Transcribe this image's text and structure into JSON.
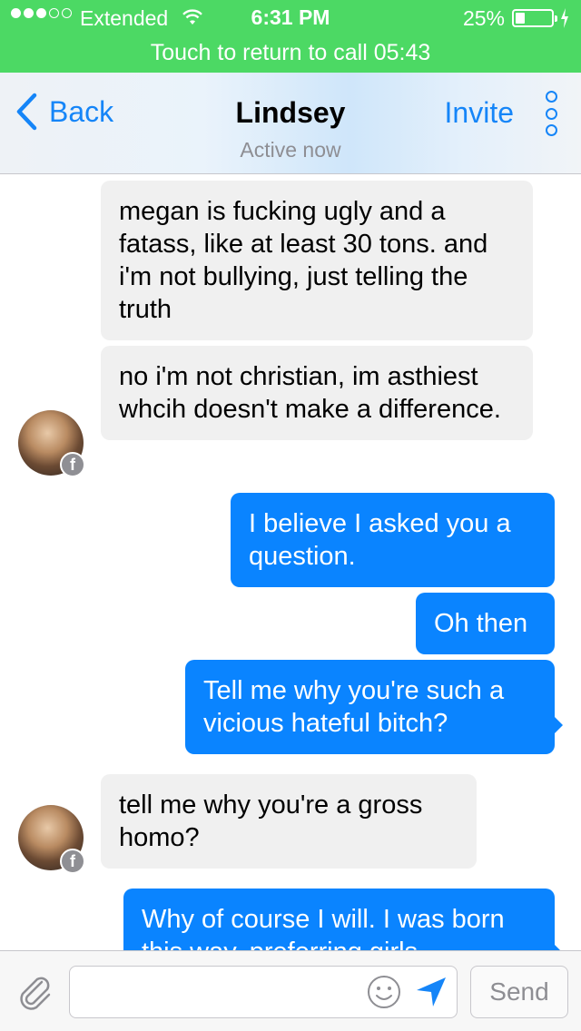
{
  "status_bar": {
    "carrier": "Extended",
    "time": "6:31 PM",
    "battery": "25%",
    "signal_bars_filled": 3,
    "signal_bars_total": 5,
    "battery_level": 0.25
  },
  "call_bar": {
    "text": "Touch to return to call  05:43"
  },
  "header": {
    "back_label": "Back",
    "title": "Lindsey",
    "subtitle": "Active now",
    "invite_label": "Invite"
  },
  "messages": [
    {
      "sender": "other",
      "text": "megan is fucking ugly and a fatass, like at least 30 tons. and i'm not bullying, just telling the truth"
    },
    {
      "sender": "other",
      "text": "no i'm not christian, im asthiest whcih doesn't make a difference."
    },
    {
      "sender": "me",
      "text": "I believe I asked you a question."
    },
    {
      "sender": "me",
      "text": "Oh then"
    },
    {
      "sender": "me",
      "text": "Tell me why you're such a vicious hateful bitch?"
    },
    {
      "sender": "other",
      "text": "tell me why you're a gross homo?"
    },
    {
      "sender": "me",
      "text": "Why of course I will. I was born this way, preferring girls"
    }
  ],
  "composer": {
    "input_value": "",
    "send_label": "Send",
    "badge_letter": "f"
  },
  "icons": {
    "wifi": "wifi-icon",
    "battery": "battery-icon",
    "back": "chevron-left-icon",
    "more": "more-vertical-icon",
    "attach": "paperclip-icon",
    "emoji": "smiley-icon",
    "location": "location-arrow-icon",
    "badge": "facebook-icon"
  },
  "colors": {
    "call_bar": "#4cd964",
    "accent": "#1585f8",
    "outgoing_bubble": "#0a84ff",
    "incoming_bubble": "#f0f0f0"
  }
}
